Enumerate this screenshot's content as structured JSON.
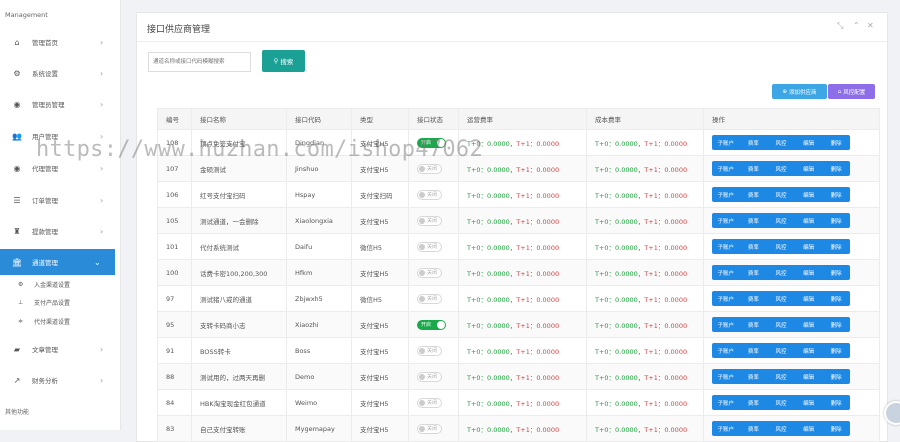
{
  "sidebar": {
    "title": "Management",
    "items": [
      {
        "label": "管理首页",
        "icon": "home-icon",
        "glyph": "⌂"
      },
      {
        "label": "系统设置",
        "icon": "gears-icon",
        "glyph": "⚙"
      },
      {
        "label": "管理员管理",
        "icon": "user-circle-icon",
        "glyph": "◉"
      },
      {
        "label": "用户管理",
        "icon": "users-icon",
        "glyph": "👥"
      },
      {
        "label": "代理管理",
        "icon": "user-circle-icon",
        "glyph": "◉"
      },
      {
        "label": "订单管理",
        "icon": "list-icon",
        "glyph": "☰"
      },
      {
        "label": "提款管理",
        "icon": "money-icon",
        "glyph": "♜"
      },
      {
        "label": "通道管理",
        "icon": "bank-icon",
        "glyph": "🏛"
      },
      {
        "label": "文章管理",
        "icon": "book-icon",
        "glyph": "▰"
      },
      {
        "label": "财务分析",
        "icon": "chart-icon",
        "glyph": "↗"
      }
    ],
    "subitems": [
      {
        "label": "入金渠道设置",
        "icon": "gear-icon",
        "glyph": "⚙"
      },
      {
        "label": "支付产品设置",
        "icon": "sitemap-icon",
        "glyph": "⊥"
      },
      {
        "label": "代付渠道设置",
        "icon": "sliders-icon",
        "glyph": "≑"
      }
    ],
    "footer": "其他功能"
  },
  "panel": {
    "title": "接口供应商管理",
    "search_placeholder": "通道名称或接口代码模糊搜索",
    "search_label": "搜索",
    "add_label": "添加供应商",
    "risk_label": "风控配置"
  },
  "table": {
    "headers": [
      "编号",
      "接口名称",
      "接口代码",
      "类型",
      "接口状态",
      "运营费率",
      "成本费率",
      "操作"
    ],
    "ops": [
      "子账户",
      "费率",
      "风控",
      "编辑",
      "删除"
    ],
    "rate_t0": "T+0：0.0000，",
    "rate_t1": "T+1：0.0000",
    "on_label": "开启",
    "off_label": "关闭",
    "rows": [
      {
        "id": "108",
        "name": "顶点免签支付宝",
        "code": "Dingdian",
        "type": "支付宝H5",
        "on": true
      },
      {
        "id": "107",
        "name": "金硕测试",
        "code": "Jinshuo",
        "type": "支付宝H5",
        "on": false
      },
      {
        "id": "106",
        "name": "红号支付宝扫码",
        "code": "Hspay",
        "type": "支付宝扫码",
        "on": false
      },
      {
        "id": "105",
        "name": "测试通道，一会删除",
        "code": "Xiaolongxia",
        "type": "支付宝H5",
        "on": false
      },
      {
        "id": "101",
        "name": "代付系统测试",
        "code": "Daifu",
        "type": "微信H5",
        "on": false
      },
      {
        "id": "100",
        "name": "话费卡密100,200,300",
        "code": "Hfkm",
        "type": "支付宝H5",
        "on": false
      },
      {
        "id": "97",
        "name": "测试猪八戒的通道",
        "code": "Zbjwxh5",
        "type": "微信H5",
        "on": false
      },
      {
        "id": "95",
        "name": "支转卡码商小志",
        "code": "Xiaozhi",
        "type": "支付宝H5",
        "on": true
      },
      {
        "id": "91",
        "name": "BOSS转卡",
        "code": "Boss",
        "type": "支付宝H5",
        "on": false
      },
      {
        "id": "88",
        "name": "测试用的，过两天再删",
        "code": "Demo",
        "type": "支付宝H5",
        "on": false
      },
      {
        "id": "84",
        "name": "HBK淘宝现金红包通道",
        "code": "Weimo",
        "type": "支付宝H5",
        "on": false
      },
      {
        "id": "83",
        "name": "自己支付宝转账",
        "code": "Mygemapay",
        "type": "支付宝H5",
        "on": false
      }
    ]
  },
  "watermark": "https://www.huzhan.com/ishop47062",
  "colors": {
    "accent": "#2a8bd8",
    "search": "#1aa094",
    "ops": "#1e88e5",
    "green": "#1a9e3a",
    "red": "#e23b3b",
    "risk": "#8e6ee8"
  }
}
